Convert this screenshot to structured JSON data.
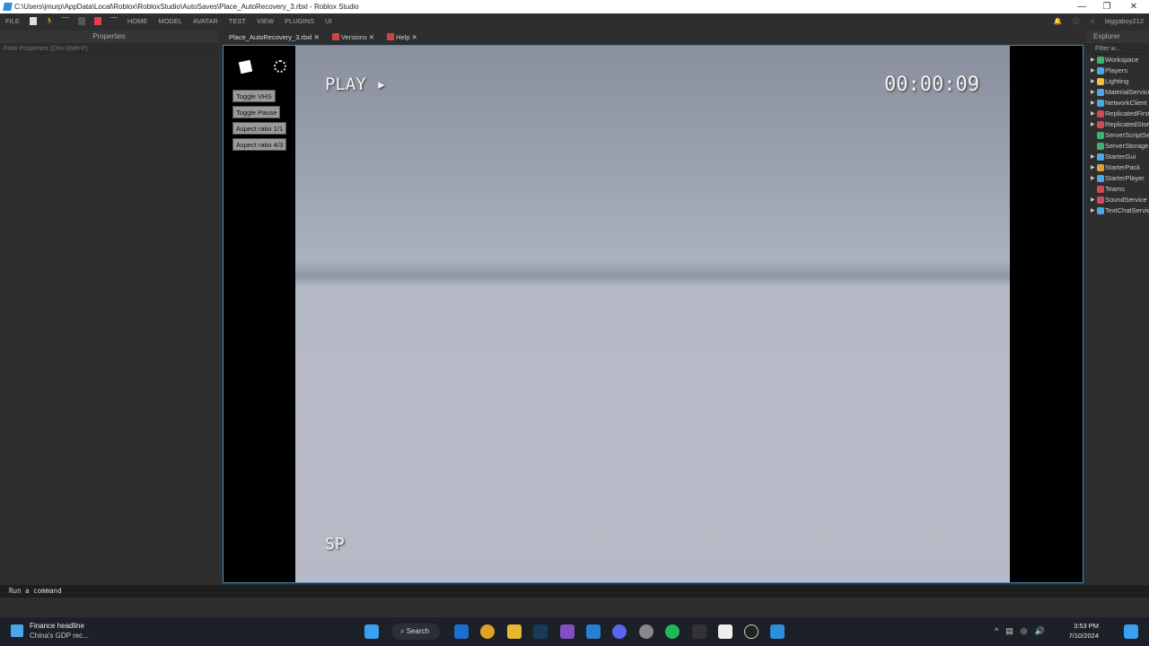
{
  "window": {
    "title": "C:\\Users\\jmurp\\AppData\\Local\\Roblox\\RobloxStudio\\AutoSaves\\Place_AutoRecovery_3.rbxl - Roblox Studio",
    "minimize": "—",
    "maximize": "❐",
    "close": "✕"
  },
  "menu": {
    "file": "FILE",
    "items": [
      "HOME",
      "MODEL",
      "AVATAR",
      "TEST",
      "VIEW",
      "PLUGINS",
      "UI"
    ],
    "user": "biggaboy212"
  },
  "properties": {
    "title": "Properties",
    "filter": "Filter Properties (Ctrl+Shift+P)"
  },
  "tabs": [
    {
      "label": "Place_AutoRecovery_3.rbxl"
    },
    {
      "label": "Versions"
    },
    {
      "label": "Help"
    }
  ],
  "viewport": {
    "play": "PLAY ▸",
    "timer": "00:00:09",
    "mode": "SP",
    "buttons": [
      "Toggle VHS",
      "Toggle Pause",
      "Aspect ratio 1/1",
      "Aspect ratio 4/3"
    ]
  },
  "explorer": {
    "title": "Explorer",
    "filter": "Filter w...",
    "items": [
      {
        "label": "Workspace",
        "color": "#3cb371"
      },
      {
        "label": "Players",
        "color": "#4aa8e8"
      },
      {
        "label": "Lighting",
        "color": "#f0c040"
      },
      {
        "label": "MaterialService",
        "color": "#4aa8e8"
      },
      {
        "label": "NetworkClient",
        "color": "#4aa8e8"
      },
      {
        "label": "ReplicatedFirst",
        "color": "#d04a5a"
      },
      {
        "label": "ReplicatedStorage",
        "color": "#d04a5a"
      },
      {
        "label": "ServerScriptService",
        "color": "#3cb371"
      },
      {
        "label": "ServerStorage",
        "color": "#3cb371"
      },
      {
        "label": "StarterGui",
        "color": "#4aa8e8"
      },
      {
        "label": "StarterPack",
        "color": "#e0a040"
      },
      {
        "label": "StarterPlayer",
        "color": "#4aa8e8"
      },
      {
        "label": "Teams",
        "color": "#d04a5a"
      },
      {
        "label": "SoundService",
        "color": "#d04a5a"
      },
      {
        "label": "TextChatService",
        "color": "#4aa8e8"
      }
    ]
  },
  "command": {
    "placeholder": "Run a command"
  },
  "taskbar": {
    "news_title": "Finance headline",
    "news_sub": "China's GDP rec...",
    "search": "Search",
    "time": "3:53 PM",
    "date": "7/10/2024"
  }
}
